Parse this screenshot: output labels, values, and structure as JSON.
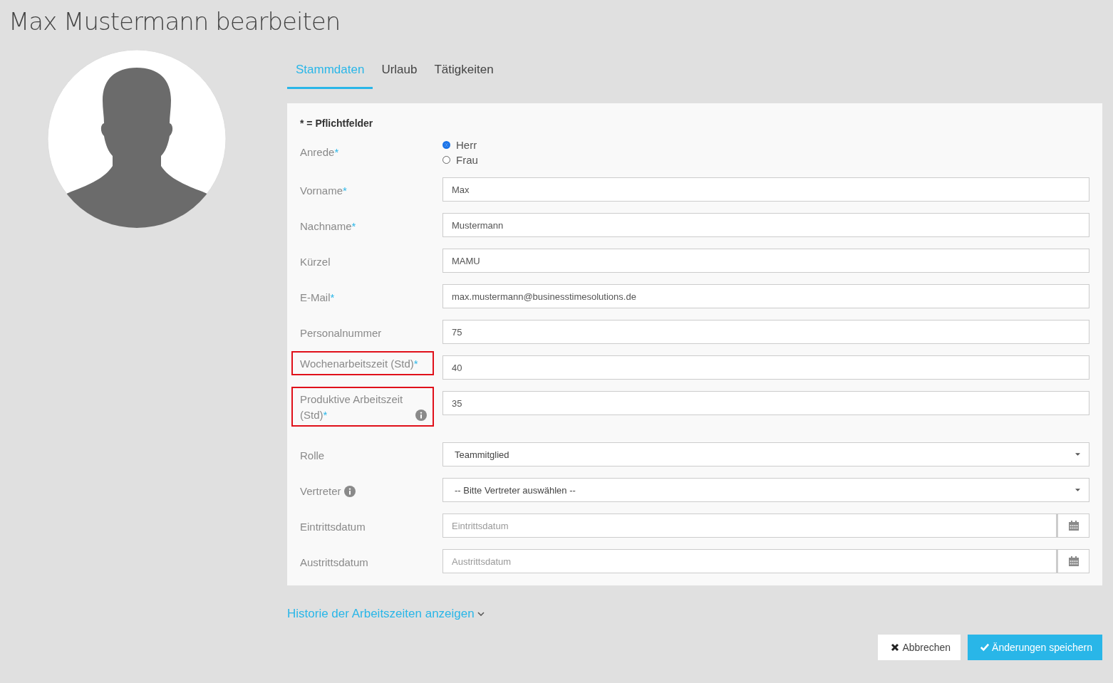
{
  "page_title": "Max Mustermann bearbeiten",
  "tabs": [
    {
      "label": "Stammdaten",
      "selected": true
    },
    {
      "label": "Urlaub",
      "selected": false
    },
    {
      "label": "Tätigkeiten",
      "selected": false
    }
  ],
  "form": {
    "legend": "* = Pflichtfelder",
    "fields": [
      {
        "kind": "radio",
        "label": "Anrede",
        "required_mark": "*",
        "options": [
          {
            "label": "Herr",
            "selected": true
          },
          {
            "label": "Frau",
            "selected": false
          }
        ]
      },
      {
        "kind": "text",
        "label": "Vorname",
        "required_mark": "*",
        "value": "Max"
      },
      {
        "kind": "text",
        "label": "Nachname",
        "required_mark": "*",
        "value": "Mustermann"
      },
      {
        "kind": "text",
        "label": "Kürzel",
        "value": "MAMU"
      },
      {
        "kind": "text",
        "label": "E-Mail",
        "required_mark": "*",
        "value": "max.mustermann@businesstimesolutions.de"
      },
      {
        "kind": "text",
        "label": "Personalnummer",
        "value": "75"
      },
      {
        "kind": "text",
        "label": "Wochenarbeitszeit (Std)",
        "required_mark": "*",
        "value": "40",
        "highlighted": true
      },
      {
        "kind": "text",
        "label": "Produktive Arbeitszeit (Std)",
        "required_mark": "*",
        "info": true,
        "value": "35",
        "highlighted": true
      },
      {
        "kind": "select",
        "label": "Rolle",
        "value": "Teammitglied"
      },
      {
        "kind": "select",
        "label": "Vertreter",
        "info": true,
        "value": "-- Bitte Vertreter auswählen --"
      },
      {
        "kind": "date",
        "label": "Eintrittsdatum",
        "placeholder": "Eintrittsdatum"
      },
      {
        "kind": "date",
        "label": "Austrittsdatum",
        "placeholder": "Austrittsdatum"
      }
    ]
  },
  "history_link": "Historie der Arbeitszeiten anzeigen",
  "buttons": [
    {
      "kind": "cancel",
      "label": "Abbrechen"
    },
    {
      "kind": "save",
      "label": "Änderungen speichern"
    }
  ]
}
